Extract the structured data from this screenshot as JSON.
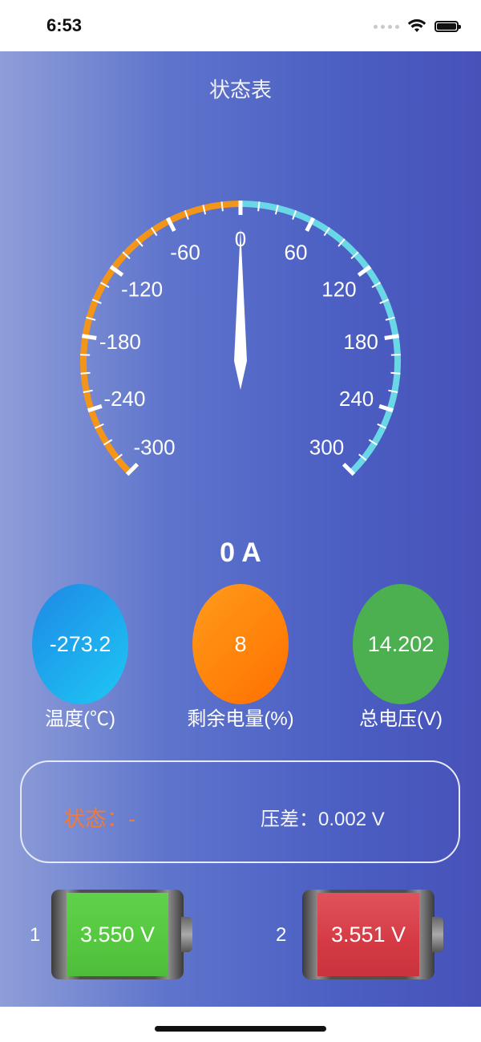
{
  "status_bar": {
    "time": "6:53"
  },
  "screen": {
    "title": "状态表"
  },
  "gauge": {
    "min": -300,
    "max": 300,
    "value": 0,
    "unit": "A",
    "labels_left": [
      "-60",
      "-120",
      "-180",
      "-240",
      "-300"
    ],
    "labels_right": [
      "60",
      "120",
      "180",
      "240",
      "300"
    ],
    "label_zero": "0",
    "colors": {
      "negative": "#f39519",
      "positive": "#6ad7e6",
      "ticks": "#ffffff"
    }
  },
  "readout": {
    "current": "0 A"
  },
  "metrics": {
    "temperature": {
      "value": "-273.2",
      "label": "温度(℃)"
    },
    "soc": {
      "value": "8",
      "label": "剩余电量(%)"
    },
    "voltage": {
      "value": "14.202",
      "label": "总电压(V)"
    }
  },
  "status_panel": {
    "state_label": "状态：",
    "state_value": "-",
    "diff_label": "压差：",
    "diff_value": "0.002 V"
  },
  "cells": [
    {
      "index": "1",
      "voltage": "3.550 V",
      "color": "green"
    },
    {
      "index": "2",
      "voltage": "3.551 V",
      "color": "red"
    }
  ]
}
